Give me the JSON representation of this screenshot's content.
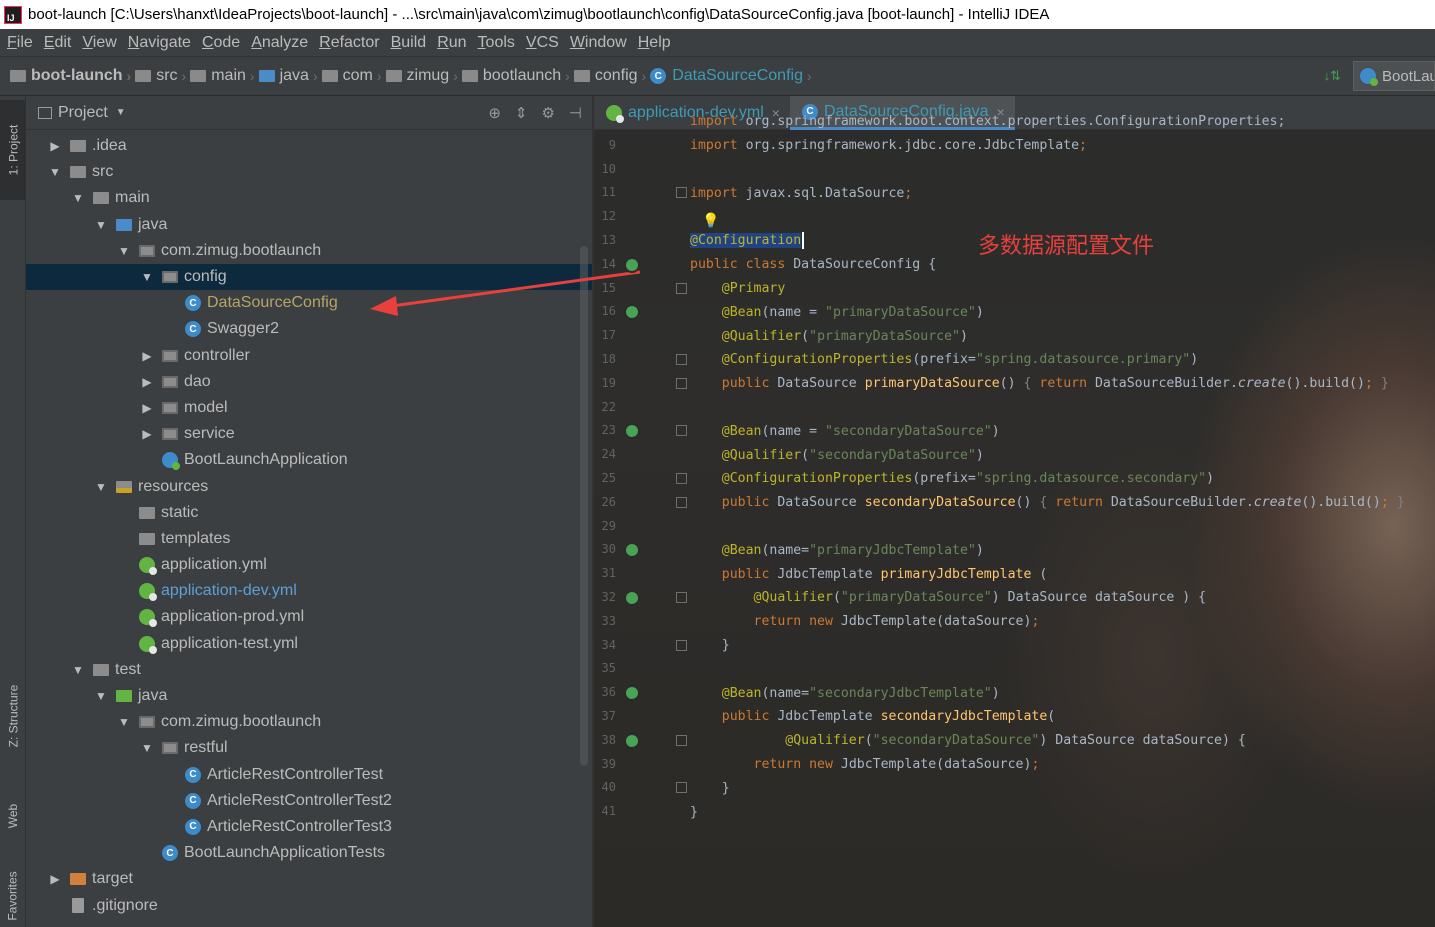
{
  "window": {
    "title": "boot-launch [C:\\Users\\hanxt\\IdeaProjects\\boot-launch] - ...\\src\\main\\java\\com\\zimug\\bootlaunch\\config\\DataSourceConfig.java [boot-launch] - IntelliJ IDEA",
    "app_logo": "IJ"
  },
  "menu": [
    "File",
    "Edit",
    "View",
    "Navigate",
    "Code",
    "Analyze",
    "Refactor",
    "Build",
    "Run",
    "Tools",
    "VCS",
    "Window",
    "Help"
  ],
  "breadcrumb": {
    "items": [
      "boot-launch",
      "src",
      "main",
      "java",
      "com",
      "zimug",
      "bootlaunch",
      "config"
    ],
    "current": "DataSourceConfig",
    "run_config": "BootLaunchApplication"
  },
  "left_strip": {
    "project": "1: Project",
    "structure": "Z: Structure",
    "web": "Web",
    "favorites": "Favorites"
  },
  "project_panel": {
    "title": "Project",
    "tree": [
      {
        "label": ".idea",
        "depth": 0,
        "arrow": "collapsed",
        "icon": "folder"
      },
      {
        "label": "src",
        "depth": 0,
        "arrow": "expanded",
        "icon": "folder"
      },
      {
        "label": "main",
        "depth": 1,
        "arrow": "expanded",
        "icon": "folder"
      },
      {
        "label": "java",
        "depth": 2,
        "arrow": "expanded",
        "icon": "folder-blue"
      },
      {
        "label": "com.zimug.bootlaunch",
        "depth": 3,
        "arrow": "expanded",
        "icon": "package"
      },
      {
        "label": "config",
        "depth": 4,
        "arrow": "expanded",
        "icon": "package",
        "selected": true
      },
      {
        "label": "DataSourceConfig",
        "depth": 5,
        "arrow": "none",
        "icon": "class",
        "color": "ylw"
      },
      {
        "label": "Swagger2",
        "depth": 5,
        "arrow": "none",
        "icon": "class"
      },
      {
        "label": "controller",
        "depth": 4,
        "arrow": "collapsed",
        "icon": "package"
      },
      {
        "label": "dao",
        "depth": 4,
        "arrow": "collapsed",
        "icon": "package"
      },
      {
        "label": "model",
        "depth": 4,
        "arrow": "collapsed",
        "icon": "package"
      },
      {
        "label": "service",
        "depth": 4,
        "arrow": "collapsed",
        "icon": "package"
      },
      {
        "label": "BootLaunchApplication",
        "depth": 4,
        "arrow": "none",
        "icon": "app"
      },
      {
        "label": "resources",
        "depth": 2,
        "arrow": "expanded",
        "icon": "resources"
      },
      {
        "label": "static",
        "depth": 3,
        "arrow": "none",
        "icon": "folder"
      },
      {
        "label": "templates",
        "depth": 3,
        "arrow": "none",
        "icon": "folder"
      },
      {
        "label": "application.yml",
        "depth": 3,
        "arrow": "none",
        "icon": "yml"
      },
      {
        "label": "application-dev.yml",
        "depth": 3,
        "arrow": "none",
        "icon": "yml",
        "color": "bluelight"
      },
      {
        "label": "application-prod.yml",
        "depth": 3,
        "arrow": "none",
        "icon": "yml"
      },
      {
        "label": "application-test.yml",
        "depth": 3,
        "arrow": "none",
        "icon": "yml"
      },
      {
        "label": "test",
        "depth": 1,
        "arrow": "expanded",
        "icon": "folder"
      },
      {
        "label": "java",
        "depth": 2,
        "arrow": "expanded",
        "icon": "folder-green"
      },
      {
        "label": "com.zimug.bootlaunch",
        "depth": 3,
        "arrow": "expanded",
        "icon": "package"
      },
      {
        "label": "restful",
        "depth": 4,
        "arrow": "expanded",
        "icon": "package"
      },
      {
        "label": "ArticleRestControllerTest",
        "depth": 5,
        "arrow": "none",
        "icon": "class"
      },
      {
        "label": "ArticleRestControllerTest2",
        "depth": 5,
        "arrow": "none",
        "icon": "class"
      },
      {
        "label": "ArticleRestControllerTest3",
        "depth": 5,
        "arrow": "none",
        "icon": "class"
      },
      {
        "label": "BootLaunchApplicationTests",
        "depth": 4,
        "arrow": "none",
        "icon": "class"
      },
      {
        "label": "target",
        "depth": 0,
        "arrow": "collapsed",
        "icon": "folder-orange"
      },
      {
        "label": ".gitignore",
        "depth": 0,
        "arrow": "none",
        "icon": "file"
      }
    ]
  },
  "editor": {
    "tabs": [
      {
        "label": "application-dev.yml",
        "active": false
      },
      {
        "label": "DataSourceConfig.java",
        "active": true
      }
    ],
    "annotation_cn": "多数据源配置文件",
    "lines": [
      {
        "n": "",
        "partial": true,
        "segs": [
          [
            "kw",
            "import "
          ],
          [
            "df",
            "org.springframework.boot.context.properties.ConfigurationProperties;"
          ]
        ]
      },
      {
        "n": "9",
        "segs": [
          [
            "kw",
            "import "
          ],
          [
            "df",
            "org.springframework.jdbc.core.JdbcTemplate"
          ],
          [
            "kw",
            ";"
          ]
        ]
      },
      {
        "n": "10",
        "segs": []
      },
      {
        "n": "11",
        "segs": [
          [
            "kw",
            "import "
          ],
          [
            "df",
            "javax.sql.DataSource"
          ],
          [
            "kw",
            ";"
          ]
        ]
      },
      {
        "n": "12",
        "segs": []
      },
      {
        "n": "13",
        "segs": [
          [
            "sel",
            "@Configuration"
          ]
        ],
        "caret": true
      },
      {
        "n": "14",
        "segs": [
          [
            "kw",
            "public class "
          ],
          [
            "df",
            "DataSourceConfig {"
          ]
        ]
      },
      {
        "n": "15",
        "segs": [
          [
            "df",
            "    "
          ],
          [
            "an",
            "@Primary"
          ]
        ]
      },
      {
        "n": "16",
        "segs": [
          [
            "df",
            "    "
          ],
          [
            "an",
            "@Bean"
          ],
          [
            "df",
            "(name = "
          ],
          [
            "st",
            "\"primaryDataSource\""
          ],
          [
            "df",
            ")"
          ]
        ]
      },
      {
        "n": "17",
        "segs": [
          [
            "df",
            "    "
          ],
          [
            "an",
            "@Qualifier"
          ],
          [
            "df",
            "("
          ],
          [
            "st",
            "\"primaryDataSource\""
          ],
          [
            "df",
            ")"
          ]
        ]
      },
      {
        "n": "18",
        "segs": [
          [
            "df",
            "    "
          ],
          [
            "an",
            "@ConfigurationProperties"
          ],
          [
            "df",
            "(prefix="
          ],
          [
            "st",
            "\"spring.datasource.primary\""
          ],
          [
            "df",
            ")"
          ]
        ]
      },
      {
        "n": "19",
        "segs": [
          [
            "df",
            "    "
          ],
          [
            "kw",
            "public "
          ],
          [
            "df",
            "DataSource "
          ],
          [
            "fn",
            "primaryDataSource"
          ],
          [
            "df",
            "() "
          ],
          [
            "gray",
            "{ "
          ],
          [
            "kw",
            "return "
          ],
          [
            "df",
            "DataSourceBuilder."
          ],
          [
            "it",
            "create"
          ],
          [
            "df",
            "().build()"
          ],
          [
            "kw",
            "; "
          ],
          [
            "gray",
            "}"
          ]
        ]
      },
      {
        "n": "22",
        "segs": []
      },
      {
        "n": "23",
        "segs": [
          [
            "df",
            "    "
          ],
          [
            "an",
            "@Bean"
          ],
          [
            "df",
            "(name = "
          ],
          [
            "st",
            "\"secondaryDataSource\""
          ],
          [
            "df",
            ")"
          ]
        ]
      },
      {
        "n": "24",
        "segs": [
          [
            "df",
            "    "
          ],
          [
            "an",
            "@Qualifier"
          ],
          [
            "df",
            "("
          ],
          [
            "st",
            "\"secondaryDataSource\""
          ],
          [
            "df",
            ")"
          ]
        ]
      },
      {
        "n": "25",
        "segs": [
          [
            "df",
            "    "
          ],
          [
            "an",
            "@ConfigurationProperties"
          ],
          [
            "df",
            "(prefix="
          ],
          [
            "st",
            "\"spring.datasource.secondary\""
          ],
          [
            "df",
            ")"
          ]
        ]
      },
      {
        "n": "26",
        "segs": [
          [
            "df",
            "    "
          ],
          [
            "kw",
            "public "
          ],
          [
            "df",
            "DataSource "
          ],
          [
            "fn",
            "secondaryDataSource"
          ],
          [
            "df",
            "() "
          ],
          [
            "gray",
            "{ "
          ],
          [
            "kw",
            "return "
          ],
          [
            "df",
            "DataSourceBuilder."
          ],
          [
            "it",
            "create"
          ],
          [
            "df",
            "().build()"
          ],
          [
            "kw",
            "; "
          ],
          [
            "gray",
            "}"
          ]
        ]
      },
      {
        "n": "29",
        "segs": []
      },
      {
        "n": "30",
        "segs": [
          [
            "df",
            "    "
          ],
          [
            "an",
            "@Bean"
          ],
          [
            "df",
            "(name="
          ],
          [
            "st",
            "\"primaryJdbcTemplate\""
          ],
          [
            "df",
            ")"
          ]
        ]
      },
      {
        "n": "31",
        "segs": [
          [
            "df",
            "    "
          ],
          [
            "kw",
            "public "
          ],
          [
            "df",
            "JdbcTemplate "
          ],
          [
            "fn",
            "primaryJdbcTemplate "
          ],
          [
            "df",
            "("
          ]
        ]
      },
      {
        "n": "32",
        "segs": [
          [
            "df",
            "        "
          ],
          [
            "an",
            "@Qualifier"
          ],
          [
            "df",
            "("
          ],
          [
            "st",
            "\"primaryDataSource\""
          ],
          [
            "df",
            ") DataSource dataSource ) {"
          ]
        ]
      },
      {
        "n": "33",
        "segs": [
          [
            "df",
            "        "
          ],
          [
            "kw",
            "return new "
          ],
          [
            "df",
            "JdbcTemplate(dataSource)"
          ],
          [
            "kw",
            ";"
          ]
        ]
      },
      {
        "n": "34",
        "segs": [
          [
            "df",
            "    }"
          ]
        ]
      },
      {
        "n": "35",
        "segs": []
      },
      {
        "n": "36",
        "segs": [
          [
            "df",
            "    "
          ],
          [
            "an",
            "@Bean"
          ],
          [
            "df",
            "(name="
          ],
          [
            "st",
            "\"secondaryJdbcTemplate\""
          ],
          [
            "df",
            ")"
          ]
        ]
      },
      {
        "n": "37",
        "segs": [
          [
            "df",
            "    "
          ],
          [
            "kw",
            "public "
          ],
          [
            "df",
            "JdbcTemplate "
          ],
          [
            "fn",
            "secondaryJdbcTemplate"
          ],
          [
            "df",
            "("
          ]
        ]
      },
      {
        "n": "38",
        "segs": [
          [
            "df",
            "            "
          ],
          [
            "an",
            "@Qualifier"
          ],
          [
            "df",
            "("
          ],
          [
            "st",
            "\"secondaryDataSource\""
          ],
          [
            "df",
            ") DataSource dataSource) {"
          ]
        ]
      },
      {
        "n": "39",
        "segs": [
          [
            "df",
            "        "
          ],
          [
            "kw",
            "return new "
          ],
          [
            "df",
            "JdbcTemplate(dataSource)"
          ],
          [
            "kw",
            ";"
          ]
        ]
      },
      {
        "n": "40",
        "segs": [
          [
            "df",
            "    }"
          ]
        ]
      },
      {
        "n": "41",
        "segs": [
          [
            "df",
            "}"
          ]
        ]
      }
    ]
  },
  "colors": {
    "bg": "#2b2b2b",
    "panel": "#3c3f41",
    "keyword": "#cc7832",
    "annotation": "#bbb529",
    "string": "#6a8759",
    "method": "#ffc66d",
    "selection": "#0d293e",
    "arrow_red": "#e8403c"
  }
}
